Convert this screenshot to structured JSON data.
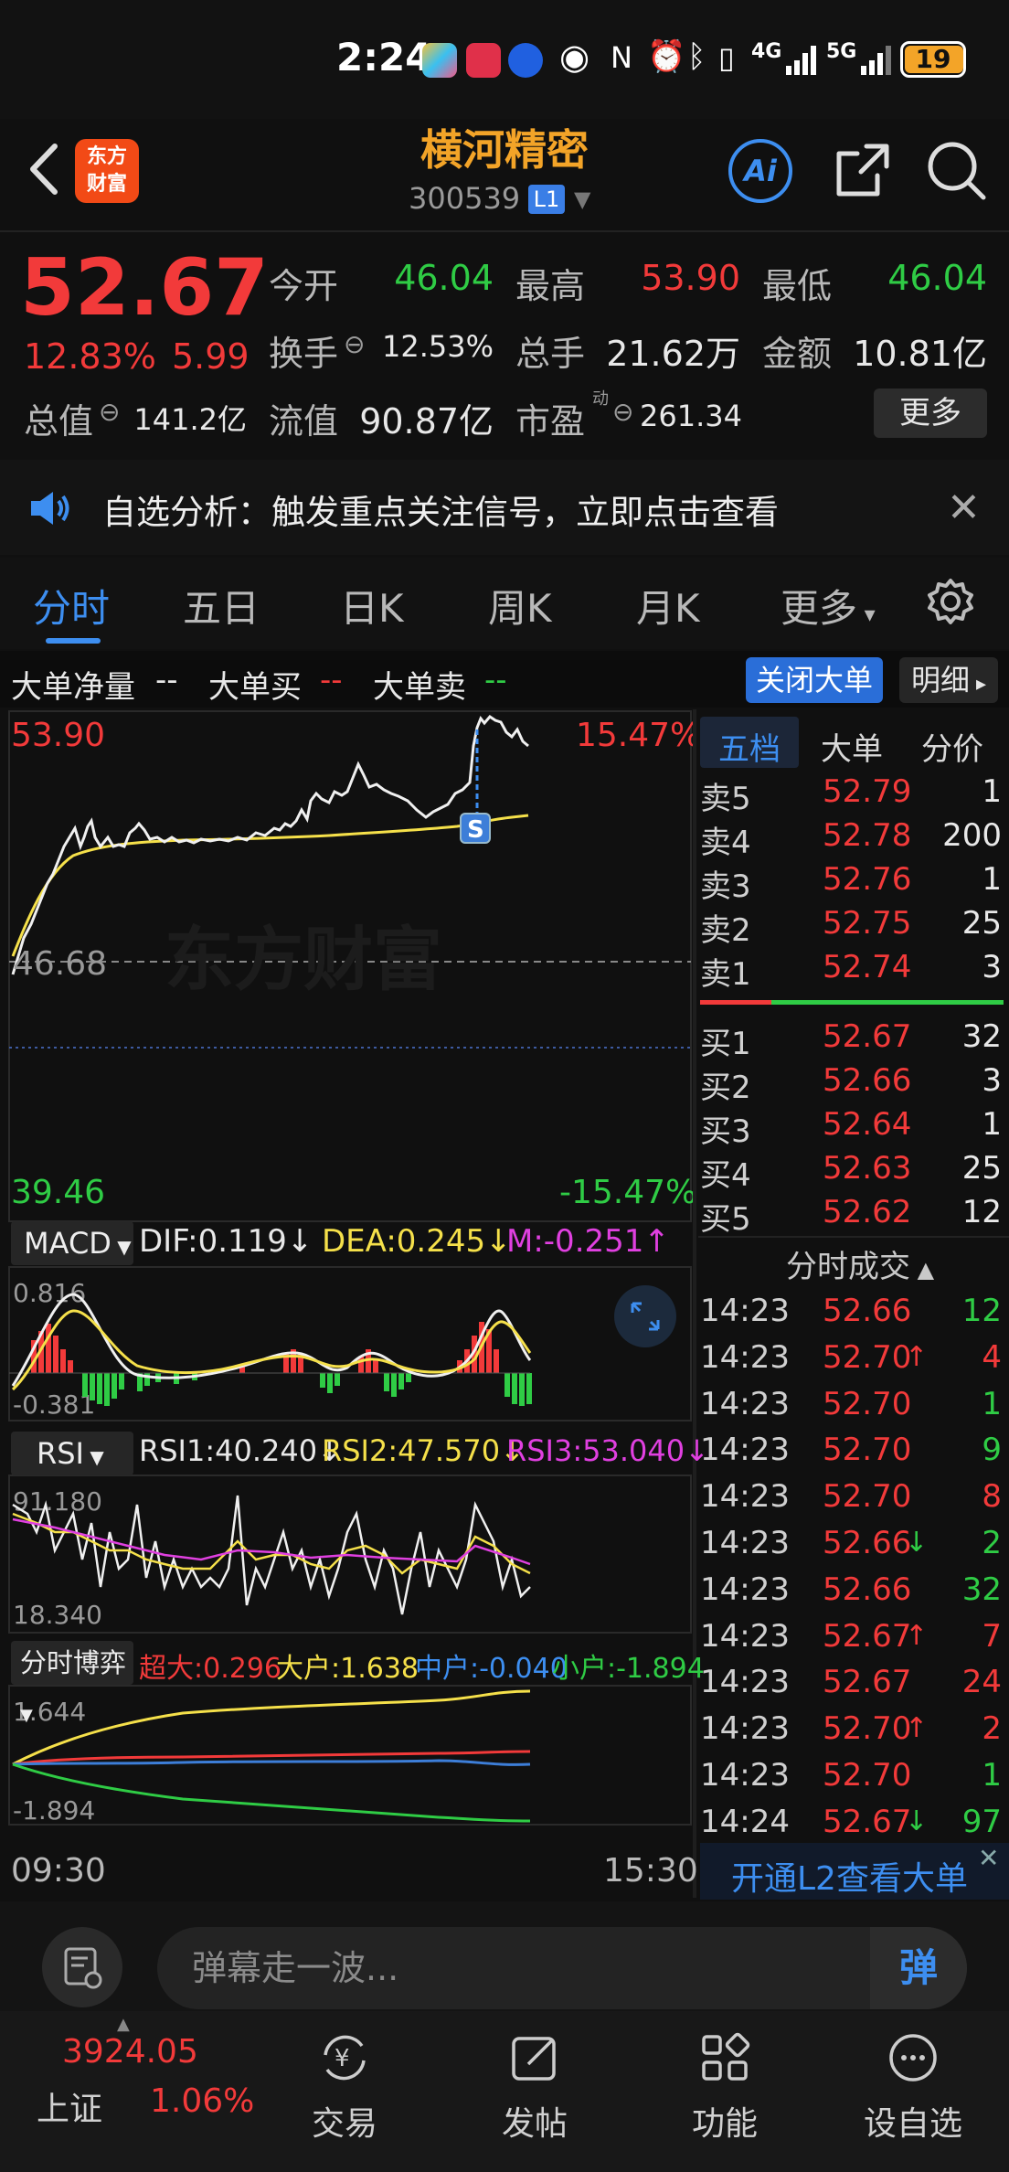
{
  "status_bar": {
    "time": "2:24",
    "battery": "19",
    "network": "5G"
  },
  "header": {
    "stock_name": "横河精密",
    "stock_code": "300539",
    "level_badge": "L1",
    "logo_text": "东方财富",
    "ai_label": "Ai"
  },
  "quote": {
    "price": "52.67",
    "change_pct": "12.83%",
    "change_val": "5.99",
    "row1": [
      {
        "label": "今开",
        "value": "46.04"
      },
      {
        "label": "最高",
        "value": "53.90"
      },
      {
        "label": "最低",
        "value": "46.04"
      }
    ],
    "row2": [
      {
        "label": "换手",
        "value": "12.53%"
      },
      {
        "label": "总手",
        "value": "21.62万"
      },
      {
        "label": "金额",
        "value": "10.81亿"
      }
    ],
    "row3": [
      {
        "label": "总值",
        "value": "141.2亿"
      },
      {
        "label": "流值",
        "value": "90.87亿"
      },
      {
        "label": "市盈",
        "sup": "动",
        "value": "261.34"
      }
    ],
    "more_label": "更多"
  },
  "notice": {
    "text": "自选分析：触发重点关注信号，立即点击查看"
  },
  "tabs": [
    "分时",
    "五日",
    "日K",
    "周K",
    "月K",
    "更多"
  ],
  "big_order_bar": {
    "net": "大单净量",
    "net_val": "--",
    "buy": "大单买",
    "buy_val": "--",
    "sell": "大单卖",
    "sell_val": "--",
    "close_label": "关闭大单",
    "detail_label": "明细"
  },
  "chart": {
    "high_price": "53.90",
    "high_pct": "15.47%",
    "mid_price": "46.68",
    "low_price": "39.46",
    "low_pct": "-15.47%",
    "watermark": "东方财富",
    "marker": "S",
    "time_start": "09:30",
    "time_end": "15:30"
  },
  "macd": {
    "name": "MACD",
    "dif": "DIF:0.119",
    "dea": "DEA:0.245",
    "m": "M:-0.251",
    "top": "0.816",
    "bottom": "-0.381"
  },
  "rsi": {
    "name": "RSI",
    "rsi1": "RSI1:40.240",
    "rsi2": "RSI2:47.570",
    "rsi3": "RSI3:53.040",
    "top": "91.180",
    "bottom": "18.340"
  },
  "bo_game": {
    "name": "分时博弈",
    "super": "超大:0.296",
    "large": "大户:1.638",
    "medium": "中户:-0.040",
    "small": "小户:-1.894",
    "top": "1.644",
    "bottom": "-1.894"
  },
  "order_book": {
    "tabs": [
      "五档",
      "大单",
      "分价"
    ],
    "asks": [
      {
        "label": "卖5",
        "price": "52.79",
        "vol": "1"
      },
      {
        "label": "卖4",
        "price": "52.78",
        "vol": "200"
      },
      {
        "label": "卖3",
        "price": "52.76",
        "vol": "1"
      },
      {
        "label": "卖2",
        "price": "52.75",
        "vol": "25"
      },
      {
        "label": "卖1",
        "price": "52.74",
        "vol": "3"
      }
    ],
    "bids": [
      {
        "label": "买1",
        "price": "52.67",
        "vol": "32"
      },
      {
        "label": "买2",
        "price": "52.66",
        "vol": "3"
      },
      {
        "label": "买3",
        "price": "52.64",
        "vol": "1"
      },
      {
        "label": "买4",
        "price": "52.63",
        "vol": "25"
      },
      {
        "label": "买5",
        "price": "52.62",
        "vol": "12"
      }
    ]
  },
  "ticks": {
    "title": "分时成交",
    "rows": [
      {
        "time": "14:23",
        "price": "52.66",
        "arrow": "",
        "vol": "12",
        "dir": "g"
      },
      {
        "time": "14:23",
        "price": "52.70",
        "arrow": "↑",
        "vol": "4",
        "dir": "r"
      },
      {
        "time": "14:23",
        "price": "52.70",
        "arrow": "",
        "vol": "1",
        "dir": "g"
      },
      {
        "time": "14:23",
        "price": "52.70",
        "arrow": "",
        "vol": "9",
        "dir": "g"
      },
      {
        "time": "14:23",
        "price": "52.70",
        "arrow": "",
        "vol": "8",
        "dir": "r"
      },
      {
        "time": "14:23",
        "price": "52.66",
        "arrow": "↓",
        "vol": "2",
        "dir": "g"
      },
      {
        "time": "14:23",
        "price": "52.66",
        "arrow": "",
        "vol": "32",
        "dir": "g"
      },
      {
        "time": "14:23",
        "price": "52.67",
        "arrow": "↑",
        "vol": "7",
        "dir": "r"
      },
      {
        "time": "14:23",
        "price": "52.67",
        "arrow": "",
        "vol": "24",
        "dir": "r"
      },
      {
        "time": "14:23",
        "price": "52.70",
        "arrow": "↑",
        "vol": "2",
        "dir": "r"
      },
      {
        "time": "14:23",
        "price": "52.70",
        "arrow": "",
        "vol": "1",
        "dir": "g"
      },
      {
        "time": "14:24",
        "price": "52.67",
        "arrow": "↓",
        "vol": "97",
        "dir": "g"
      }
    ],
    "l2_banner": "开通L2查看大单"
  },
  "danmaku": {
    "placeholder": "弹幕走一波...",
    "send_label": "弹"
  },
  "bottom_nav": {
    "index_value": "3924.05",
    "index_name": "上证",
    "index_pct": "1.06%",
    "items": [
      "交易",
      "发帖",
      "功能",
      "设自选"
    ]
  },
  "colors": {
    "up": "#f23a3a",
    "down": "#2fcc45",
    "accent": "#3d8ef0",
    "brand": "#f3a428"
  }
}
